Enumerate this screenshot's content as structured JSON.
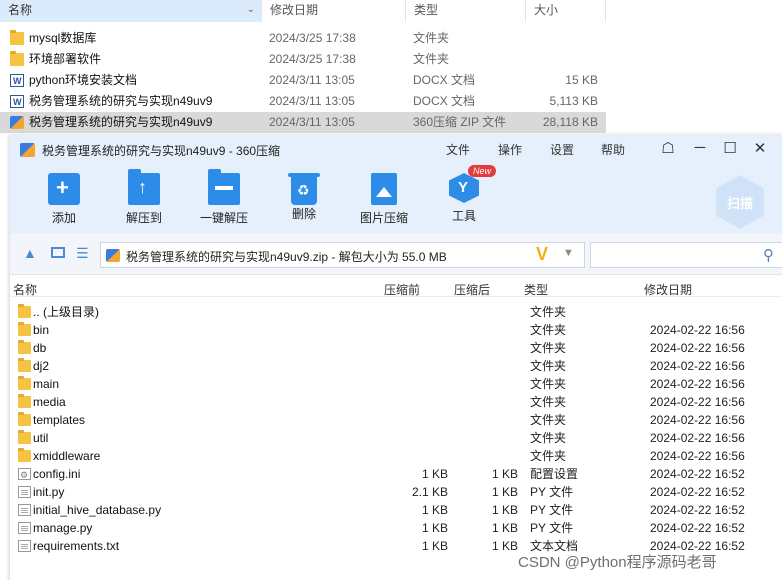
{
  "explorer": {
    "columns": {
      "name": "名称",
      "date": "修改日期",
      "type": "类型",
      "size": "大小"
    },
    "rows": [
      {
        "name": "mysql数据库",
        "date": "2024/3/25 17:38",
        "type": "文件夹",
        "size": "",
        "icon": "folder-icon"
      },
      {
        "name": "环境部署软件",
        "date": "2024/3/25 17:38",
        "type": "文件夹",
        "size": "",
        "icon": "folder-icon"
      },
      {
        "name": "python环境安装文档",
        "date": "2024/3/11 13:05",
        "type": "DOCX 文档",
        "size": "15 KB",
        "icon": "docx-icon"
      },
      {
        "name": "税务管理系统的研究与实现n49uv9",
        "date": "2024/3/11 13:05",
        "type": "DOCX 文档",
        "size": "5,113 KB",
        "icon": "docx-icon"
      },
      {
        "name": "税务管理系统的研究与实现n49uv9",
        "date": "2024/3/11 13:05",
        "type": "360压缩 ZIP 文件",
        "size": "28,118 KB",
        "icon": "zip-icon",
        "selected": true
      }
    ]
  },
  "zipwin": {
    "title": "税务管理系统的研究与实现n49uv9 - 360压缩",
    "menu": {
      "file": "文件",
      "ops": "操作",
      "settings": "设置",
      "help": "帮助"
    },
    "toolbar": {
      "add": "添加",
      "extract": "解压到",
      "oneclick": "一键解压",
      "delete": "删除",
      "image": "图片压缩",
      "tools": "工具",
      "new_badge": "New",
      "scan": "扫描"
    },
    "path": "税务管理系统的研究与实现n49uv9.zip - 解包大小为 55.0 MB",
    "path_badge": "V",
    "columns": {
      "name": "名称",
      "compressed": "压缩前",
      "packed": "压缩后",
      "type": "类型",
      "date": "修改日期"
    },
    "rows": [
      {
        "name": ".. (上级目录)",
        "compressed": "",
        "packed": "",
        "type": "文件夹",
        "date": "",
        "icon": "folder-icon"
      },
      {
        "name": "bin",
        "compressed": "",
        "packed": "",
        "type": "文件夹",
        "date": "2024-02-22 16:56",
        "icon": "folder-icon"
      },
      {
        "name": "db",
        "compressed": "",
        "packed": "",
        "type": "文件夹",
        "date": "2024-02-22 16:56",
        "icon": "folder-icon"
      },
      {
        "name": "dj2",
        "compressed": "",
        "packed": "",
        "type": "文件夹",
        "date": "2024-02-22 16:56",
        "icon": "folder-icon"
      },
      {
        "name": "main",
        "compressed": "",
        "packed": "",
        "type": "文件夹",
        "date": "2024-02-22 16:56",
        "icon": "folder-icon"
      },
      {
        "name": "media",
        "compressed": "",
        "packed": "",
        "type": "文件夹",
        "date": "2024-02-22 16:56",
        "icon": "folder-icon"
      },
      {
        "name": "templates",
        "compressed": "",
        "packed": "",
        "type": "文件夹",
        "date": "2024-02-22 16:56",
        "icon": "folder-icon"
      },
      {
        "name": "util",
        "compressed": "",
        "packed": "",
        "type": "文件夹",
        "date": "2024-02-22 16:56",
        "icon": "folder-icon"
      },
      {
        "name": "xmiddleware",
        "compressed": "",
        "packed": "",
        "type": "文件夹",
        "date": "2024-02-22 16:56",
        "icon": "folder-icon"
      },
      {
        "name": "config.ini",
        "compressed": "1 KB",
        "packed": "1 KB",
        "type": "配置设置",
        "date": "2024-02-22 16:52",
        "icon": "config-file-icon"
      },
      {
        "name": "init.py",
        "compressed": "2.1 KB",
        "packed": "1 KB",
        "type": "PY 文件",
        "date": "2024-02-22 16:52",
        "icon": "file-icon"
      },
      {
        "name": "initial_hive_database.py",
        "compressed": "1 KB",
        "packed": "1 KB",
        "type": "PY 文件",
        "date": "2024-02-22 16:52",
        "icon": "file-icon"
      },
      {
        "name": "manage.py",
        "compressed": "1 KB",
        "packed": "1 KB",
        "type": "PY 文件",
        "date": "2024-02-22 16:52",
        "icon": "file-icon"
      },
      {
        "name": "requirements.txt",
        "compressed": "1 KB",
        "packed": "1 KB",
        "type": "文本文档",
        "date": "2024-02-22 16:52",
        "icon": "text-file-icon"
      }
    ]
  },
  "watermark": "CSDN @Python程序源码老哥"
}
